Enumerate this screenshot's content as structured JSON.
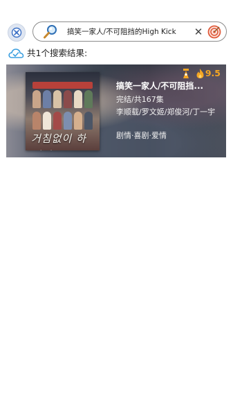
{
  "search": {
    "query": "搞笑一家人/不可阻挡的High Kick",
    "clear_glyph": "✕"
  },
  "results": {
    "count_label": "共1个搜索结果:"
  },
  "card": {
    "score": "9.5",
    "title": "搞笑一家人/不可阻挡...",
    "status": "完结/共167集",
    "cast": "李顺载/罗文姬/郑俊河/丁一宇",
    "genre": "剧情·喜剧·爱情",
    "poster_title": "거침없이 하이킥"
  },
  "colors": {
    "accent": "#f5a623",
    "cloud": "#3b9fe0",
    "target": "#e05a3a"
  },
  "icons": {
    "app": "app-logo-icon",
    "search": "magnifier-icon",
    "clear": "close-icon",
    "target": "target-icon",
    "cloud": "cloud-check-icon",
    "rank": "rank-icon",
    "flame": "flame-icon"
  }
}
